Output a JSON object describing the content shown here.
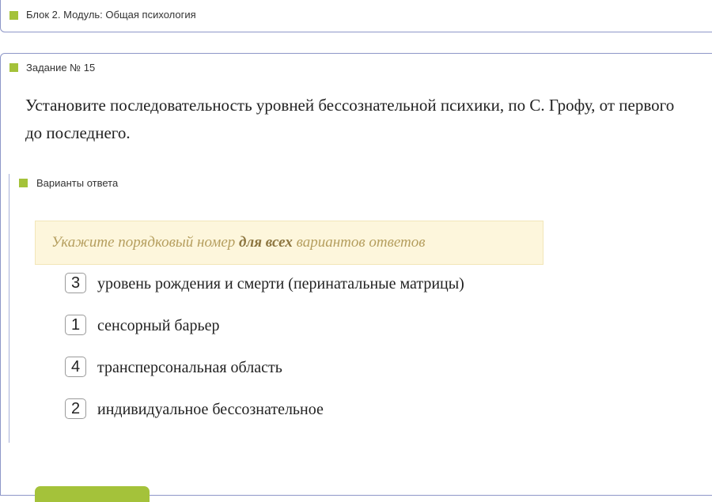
{
  "block": {
    "title": "Блок 2. Модуль: Общая психология"
  },
  "task": {
    "title": "Задание № 15",
    "question": "Установите последовательность уровней бессознательной психики, по С. Грофу, от первого до последнего."
  },
  "answers": {
    "title": "Варианты ответа",
    "hint_before": "Укажите порядковый номер ",
    "hint_bold": "для всех",
    "hint_after": " вариантов ответов",
    "options": [
      {
        "number": "3",
        "text": "уровень рождения и смерти (перинатальные матрицы)"
      },
      {
        "number": "1",
        "text": "сенсорный барьер"
      },
      {
        "number": "4",
        "text": "трансперсональная область"
      },
      {
        "number": "2",
        "text": "индивидуальное бессознательное"
      }
    ]
  },
  "colors": {
    "accent": "#a4c23a",
    "panel_border": "#8e97c8",
    "hint_bg": "#fdf6dc",
    "hint_text": "#b59e5e"
  }
}
